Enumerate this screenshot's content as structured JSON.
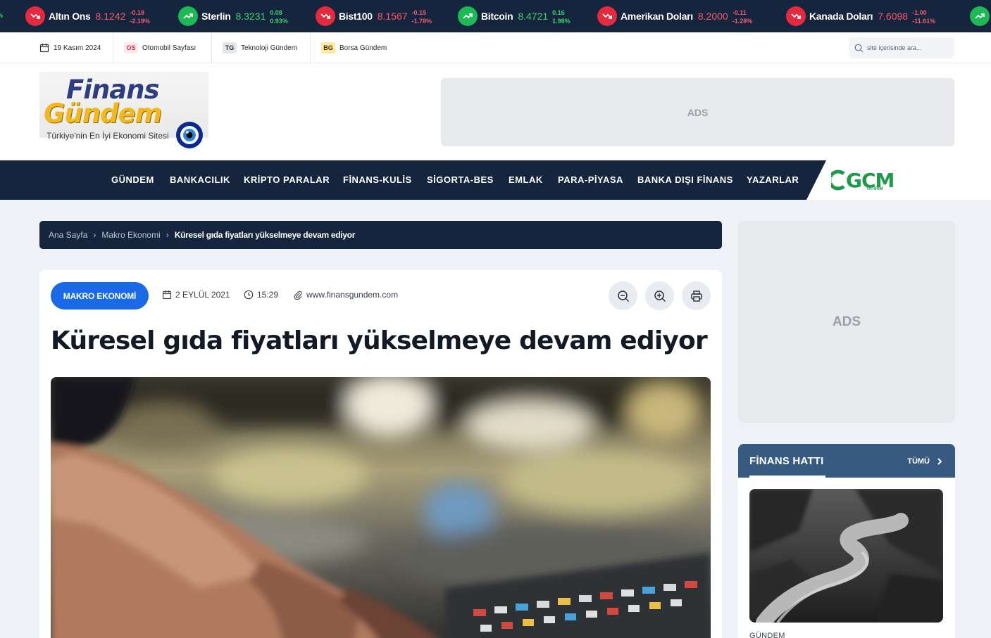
{
  "ticker": {
    "items": [
      {
        "name": "Altın Ons",
        "value": "8.1242",
        "change": "-0.18",
        "percent": "-2.19%",
        "trend": "down"
      },
      {
        "name": "Sterlin",
        "value": "8.3231",
        "change": "0.08",
        "percent": "0.93%",
        "trend": "up"
      },
      {
        "name": "Bist100",
        "value": "8.1567",
        "change": "-0.15",
        "percent": "-1.78%",
        "trend": "down"
      },
      {
        "name": "Bitcoin",
        "value": "8.4721",
        "change": "0.16",
        "percent": "1.98%",
        "trend": "up"
      },
      {
        "name": "Amerikan Doları",
        "value": "8.2000",
        "change": "-0.11",
        "percent": "-1.28%",
        "trend": "down"
      },
      {
        "name": "Kanada Doları",
        "value": "7.6098",
        "change": "-1.00",
        "percent": "-11.61%",
        "trend": "down"
      }
    ],
    "edge_fragment": "%"
  },
  "topbar": {
    "date": "19 Kasım 2024",
    "links": [
      {
        "badge": "OS",
        "label": "Otomobil Sayfası"
      },
      {
        "badge": "TG",
        "label": "Teknoloji Gündem"
      },
      {
        "badge": "BG",
        "label": "Borsa Gündem"
      }
    ],
    "search_placeholder": "site içerisinde ara..."
  },
  "logo": {
    "line1": "Finans",
    "line2": "Gündem",
    "tagline": "Türkiye'nin En İyi Ekonomi Sitesi"
  },
  "ads_label": "ADS",
  "nav": {
    "items": [
      "GÜNDEM",
      "BANKACILIK",
      "KRİPTO PARALAR",
      "FİNANS-KULİS",
      "SİGORTA-BES",
      "EMLAK",
      "PARA-PİYASA",
      "BANKA DIŞI FİNANS",
      "YAZARLAR"
    ],
    "partner_logo": "GCM",
    "partner_sub": "YATIRIM"
  },
  "breadcrumb": [
    "Ana Sayfa",
    "Makro Ekonomi",
    "Küresel gıda fiyatları yükselmeye devam ediyor"
  ],
  "article": {
    "category": "MAKRO EKONOMİ",
    "date": "2 EYLÜL 2021",
    "time": "15:29",
    "source": "www.finansgundem.com",
    "title": "Küresel gıda fiyatları yükselmeye devam ediyor"
  },
  "sidebar": {
    "ads_label": "ADS",
    "finans_hatti_title": "FİNANS HATTI",
    "all_label": "TÜMÜ",
    "first_item_category": "GÜNDEM"
  },
  "colors": {
    "navy": "#16253e",
    "accent_blue": "#1a6ae8",
    "up_green": "#1db954",
    "down_red": "#e5293e",
    "panel_blue": "#365a80"
  }
}
